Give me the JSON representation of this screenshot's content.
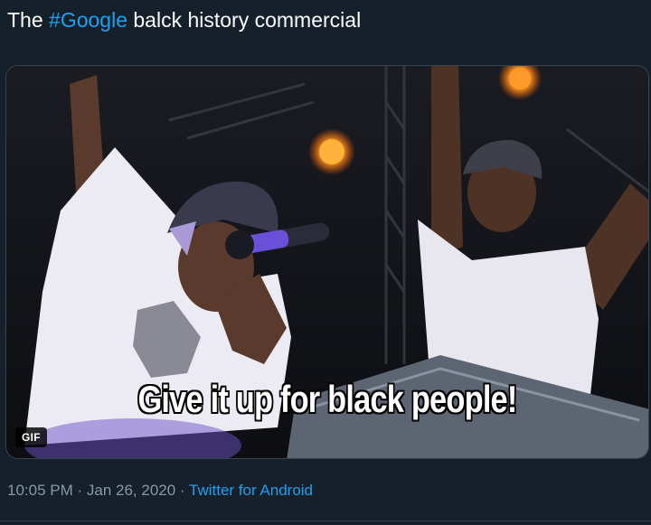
{
  "tweet": {
    "text_before": "The ",
    "hashtag": "#Google",
    "text_after": " balck history commercial"
  },
  "media": {
    "caption": "Give it up for black people!",
    "badge": "GIF"
  },
  "meta": {
    "time": "10:05 PM",
    "separator1": " · ",
    "date": "Jan 26, 2020",
    "separator2": " · ",
    "source": "Twitter for Android"
  },
  "colors": {
    "background": "#15202b",
    "text": "#ffffff",
    "link": "#1da1f2",
    "secondary": "#8899a6"
  }
}
